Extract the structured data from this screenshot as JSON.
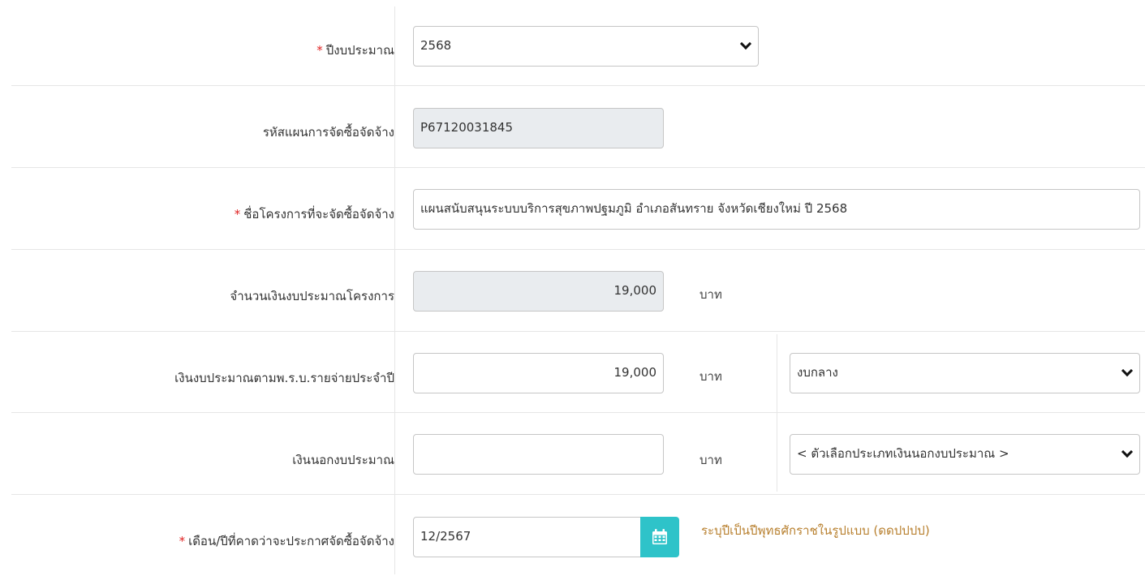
{
  "form": {
    "fiscal_year": {
      "required": "*",
      "label": "ปีงบประมาณ",
      "value": "2568"
    },
    "plan_code": {
      "label": "รหัสแผนการจัดซื้อจัดจ้าง",
      "value": "P67120031845"
    },
    "project_name": {
      "required": "*",
      "label": "ชื่อโครงการที่จะจัดซื้อจัดจ้าง",
      "value": "แผนสนับสนุนระบบบริการสุขภาพปฐมภูมิ อำเภอสันทราย จังหวัดเชียงใหม่ ปี 2568"
    },
    "project_budget": {
      "label": "จำนวนเงินงบประมาณโครงการ",
      "value": "19,000",
      "unit": "บาท"
    },
    "annual_budget": {
      "label": "เงินงบประมาณตามพ.ร.บ.รายจ่ายประจำปี",
      "value": "19,000",
      "unit": "บาท",
      "type_value": "งบกลาง"
    },
    "off_budget": {
      "label": "เงินนอกงบประมาณ",
      "value": "",
      "unit": "บาท",
      "type_value": "< ตัวเลือกประเภทเงินนอกงบประมาณ >"
    },
    "announce_month": {
      "required": "*",
      "label": "เดือน/ปีที่คาดว่าจะประกาศจัดซื้อจัดจ้าง",
      "value": "12/2567",
      "hint": "ระบุปีเป็นปีพุทธศักราชในรูปแบบ (ดดปปปป)"
    }
  },
  "colors": {
    "required": "#e02424",
    "calendar_button": "#2ec3c9",
    "hint": "#b8802f",
    "readonly_bg": "#e9ecef"
  },
  "icons": {
    "calendar": "calendar-icon",
    "dropdown": "chevron-down-icon"
  }
}
